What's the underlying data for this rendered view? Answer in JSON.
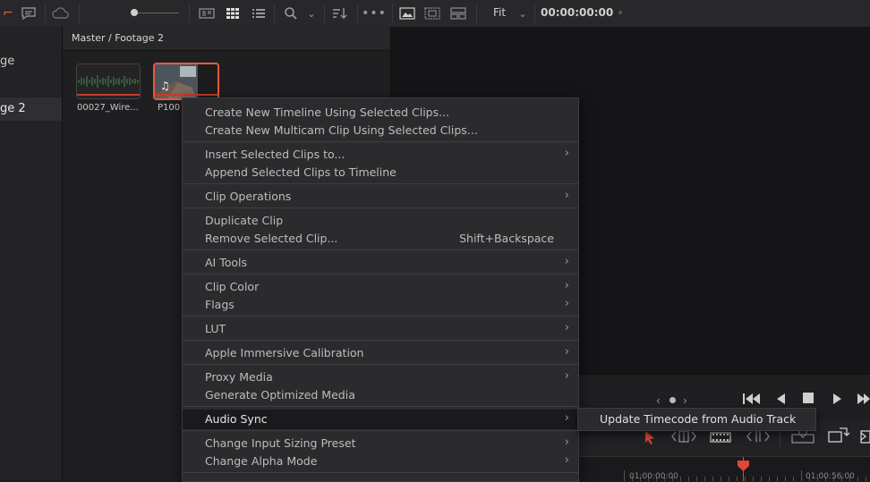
{
  "toolbar": {
    "fit_label": "Fit",
    "timecode": "00:00:00:00"
  },
  "bins": {
    "item1": "ge",
    "item2": "ge 2"
  },
  "pool": {
    "breadcrumb": "Master / Footage 2",
    "clips": [
      {
        "label": "00027_Wire..."
      },
      {
        "label": "P100"
      }
    ]
  },
  "menu": {
    "items": [
      {
        "label": "Create New Timeline Using Selected Clips..."
      },
      {
        "label": "Create New Multicam Clip Using Selected Clips..."
      },
      {
        "label": "Insert Selected Clips to...",
        "arrow": "›"
      },
      {
        "label": "Append Selected Clips to Timeline"
      },
      {
        "label": "Clip Operations",
        "arrow": "›"
      },
      {
        "label": "Duplicate Clip"
      },
      {
        "label": "Remove Selected Clip...",
        "shortcut": "Shift+Backspace"
      },
      {
        "label": "AI Tools",
        "arrow": "›"
      },
      {
        "label": "Clip Color",
        "arrow": "›"
      },
      {
        "label": "Flags",
        "arrow": "›"
      },
      {
        "label": "LUT",
        "arrow": "›"
      },
      {
        "label": "Apple Immersive Calibration",
        "arrow": "›"
      },
      {
        "label": "Proxy Media",
        "arrow": "›"
      },
      {
        "label": "Generate Optimized Media"
      },
      {
        "label": "Audio Sync",
        "arrow": "›"
      },
      {
        "label": "Change Input Sizing Preset",
        "arrow": "›"
      },
      {
        "label": "Change Alpha Mode",
        "arrow": "›"
      }
    ]
  },
  "submenu": {
    "label": "Update Timecode from Audio Track"
  },
  "ruler": {
    "tc1": "01:00:00:00",
    "tc2": "01:00:56:00"
  }
}
